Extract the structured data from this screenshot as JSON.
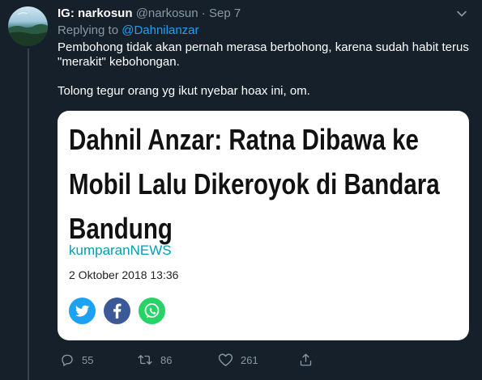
{
  "tweet": {
    "display_name": "IG: narkosun",
    "handle": "@narkosun",
    "separator": "·",
    "date": "Sep 7",
    "replying_prefix": "Replying to",
    "replying_handle": "@Dahnilanzar",
    "paragraphs": [
      "Pembohong tidak akan pernah merasa berbohong, karena sudah habit terus \"merakit\" kebohongan.",
      "Tolong tegur orang yg ikut nyebar hoax ini, om."
    ]
  },
  "card": {
    "headline": "Dahnil Anzar: Ratna Dibawa ke Mobil Lalu Dikeroyok di Bandara Bandung",
    "source": "kumparanNEWS",
    "date": "2 Oktober 2018 13:36",
    "share_icons": [
      "twitter-icon",
      "facebook-icon",
      "whatsapp-icon"
    ]
  },
  "actions": {
    "reply_count": "55",
    "retweet_count": "86",
    "like_count": "261"
  },
  "colors": {
    "background": "#15202b",
    "muted": "#8899a6",
    "link": "#1da1f2",
    "card_source": "#00a0b2"
  }
}
